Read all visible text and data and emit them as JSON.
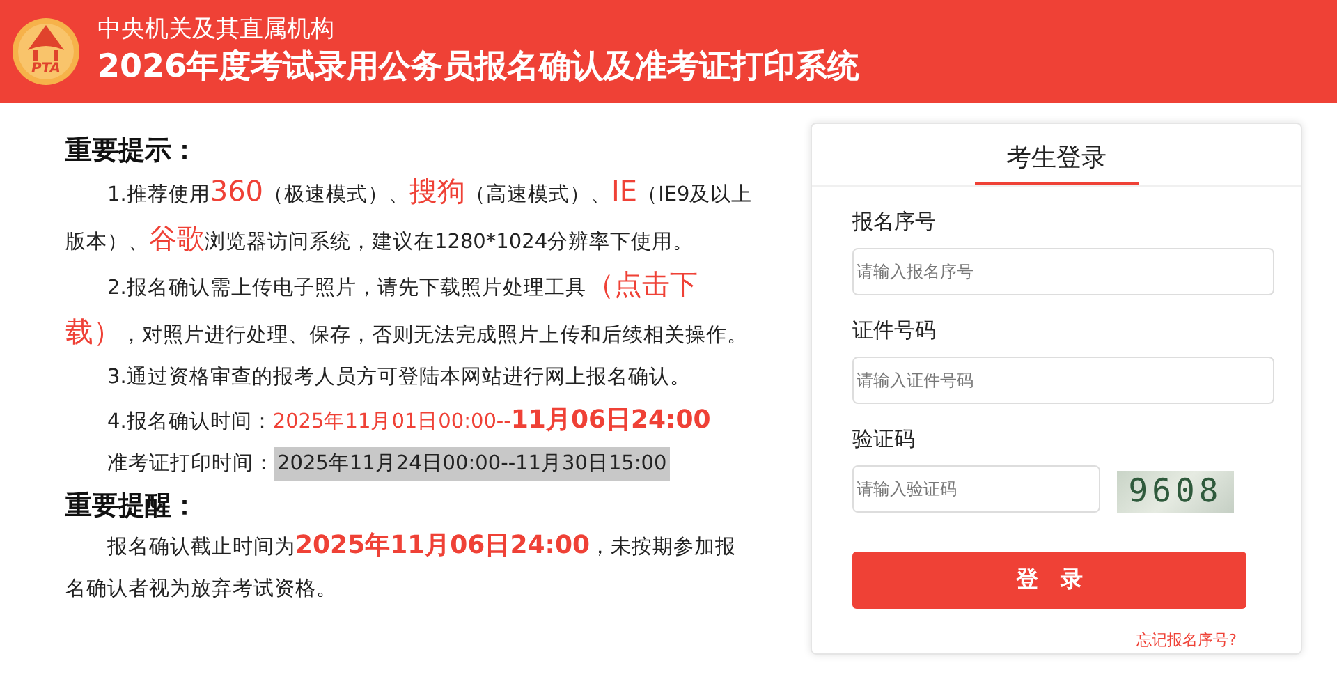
{
  "header": {
    "logo_text": "PTA",
    "subtitle": "中央机关及其直属机构",
    "title": "2026年度考试录用公务员报名确认及准考证打印系统"
  },
  "notice": {
    "sections": [
      {
        "heading": "重要提示：",
        "paragraphs": [
          {
            "segments": [
              {
                "kind": "plain",
                "text": "1.推荐使用"
              },
              {
                "kind": "accent",
                "text": "360"
              },
              {
                "kind": "plain",
                "text": "（极速模式）、"
              },
              {
                "kind": "accent",
                "text": "搜狗"
              },
              {
                "kind": "plain",
                "text": "（高速模式）、"
              },
              {
                "kind": "accent",
                "text": "IE"
              },
              {
                "kind": "plain",
                "text": "（IE9及以上版本）、"
              },
              {
                "kind": "accent",
                "text": "谷歌"
              },
              {
                "kind": "plain",
                "text": "浏览器访问系统，建议在1280*1024分辨率下使用。"
              }
            ]
          },
          {
            "segments": [
              {
                "kind": "plain",
                "text": "2.报名确认需上传电子照片，请先下载照片处理工具"
              },
              {
                "kind": "accent",
                "text": "（点击下载）"
              },
              {
                "kind": "plain",
                "text": "，对照片进行处理、保存，否则无法完成照片上传和后续相关操作。"
              }
            ]
          },
          {
            "segments": [
              {
                "kind": "plain",
                "text": "3.通过资格审查的报考人员方可登陆本网站进行网上报名确认。"
              }
            ]
          },
          {
            "segments": [
              {
                "kind": "plain",
                "text": "4.报名确认时间："
              },
              {
                "kind": "red",
                "text": "2025年11月01日00:00--"
              },
              {
                "kind": "strong",
                "text": "11月06日24:00"
              }
            ]
          },
          {
            "segments": [
              {
                "kind": "plain",
                "text": "准考证打印时间："
              },
              {
                "kind": "marked",
                "text": "2025年11月24日00:00--11月30日15:00"
              }
            ]
          }
        ]
      },
      {
        "heading": "重要提醒：",
        "paragraphs": [
          {
            "segments": [
              {
                "kind": "plain",
                "text": "报名确认截止时间为"
              },
              {
                "kind": "strong",
                "text": "2025年11月06日24:00"
              },
              {
                "kind": "plain",
                "text": "，未按期参加报名确认者视为放弃考试资格。"
              }
            ]
          }
        ]
      }
    ]
  },
  "login": {
    "title": "考生登录",
    "fields": [
      {
        "label": "报名序号",
        "placeholder": "请输入报名序号",
        "kind": "text"
      },
      {
        "label": "证件号码",
        "placeholder": "请输入证件号码",
        "kind": "text"
      },
      {
        "label": "验证码",
        "placeholder": "请输入验证码",
        "kind": "captcha",
        "captcha": "9608"
      }
    ],
    "button": "登　录",
    "forgot_link": "忘记报名序号?"
  }
}
